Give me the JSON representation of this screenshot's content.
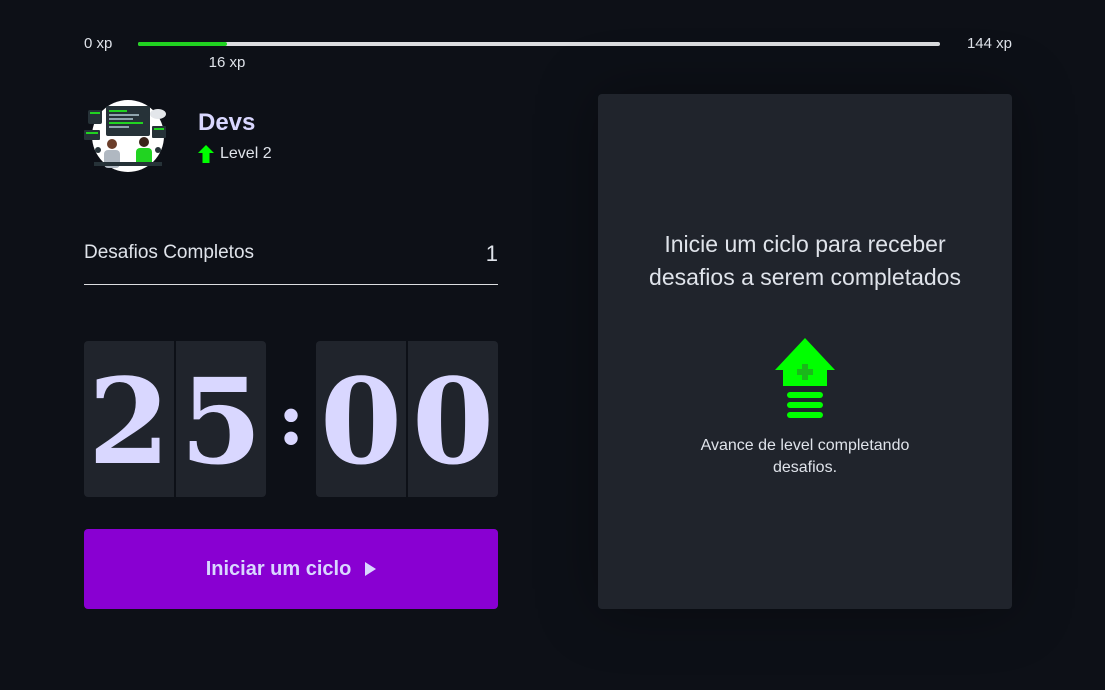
{
  "experience": {
    "min_label": "0 xp",
    "max_label": "144 xp",
    "current_label": "16 xp",
    "progress_fraction": 0.111,
    "fill_color": "#21d321"
  },
  "profile": {
    "name": "Devs",
    "level_label": "Level 2",
    "avatar_icon": "developers-illustration",
    "level_icon": "level-up-arrow-icon"
  },
  "completed_challenges": {
    "label": "Desafios Completos",
    "count": "1"
  },
  "countdown": {
    "minute_left": "2",
    "minute_right": "5",
    "separator": ":",
    "second_left": "0",
    "second_right": "0"
  },
  "start_button": {
    "label": "Iniciar um ciclo",
    "icon": "play-icon",
    "color": "#8900d2"
  },
  "challenge_panel": {
    "title": "Inicie um ciclo para receber desafios a serem completados",
    "icon": "level-up-icon",
    "hint": "Avance de level completando desafios."
  },
  "colors": {
    "background": "#0d1017",
    "panel": "#20242c",
    "accent_green": "#00ff00",
    "text_light": "#d9d7ff"
  }
}
